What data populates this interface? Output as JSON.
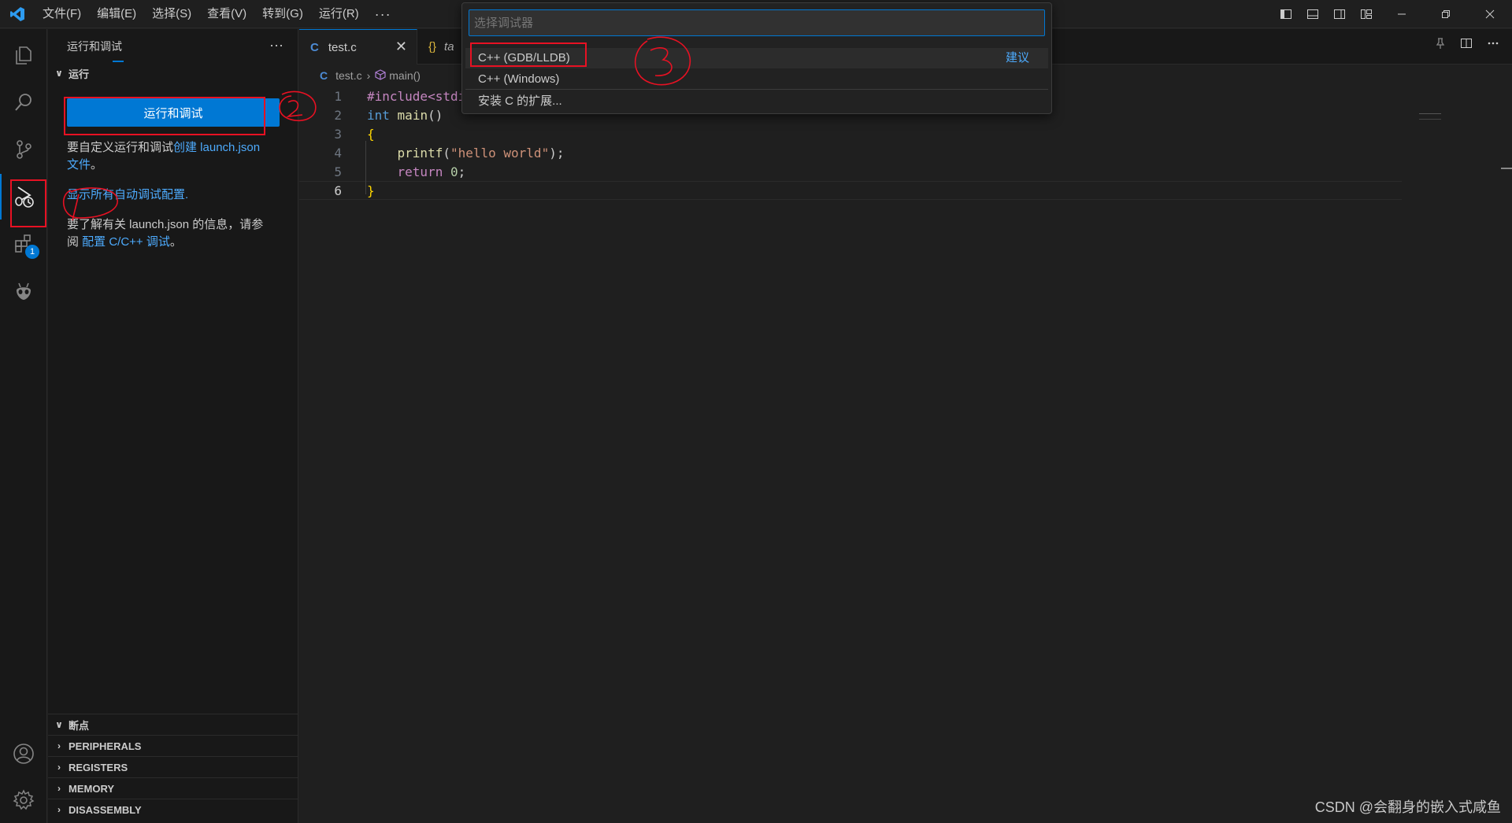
{
  "menubar": {
    "items": [
      "文件(F)",
      "编辑(E)",
      "选择(S)",
      "查看(V)",
      "转到(G)",
      "运行(R)"
    ],
    "more": "···"
  },
  "sidebar": {
    "title": "运行和调试",
    "title_more": "···",
    "section": "运行",
    "run_button": "运行和调试",
    "customize_prefix": "要自定义运行和调试",
    "customize_link_line1": "创建 launch.json",
    "customize_link_line2": "文件",
    "customize_suffix": "。",
    "show_all_link": "显示所有自动调试配置.",
    "learn_line1": "要了解有关 launch.json 的信息，请参",
    "learn_prefix2": "阅 ",
    "learn_link": "配置 C/C++ 调试",
    "learn_suffix": "。",
    "bottom_sections": [
      "断点",
      "PERIPHERALS",
      "REGISTERS",
      "MEMORY",
      "DISASSEMBLY"
    ]
  },
  "activitybar": {
    "extensions_badge": "1"
  },
  "editor": {
    "tabs": [
      {
        "icon": "C",
        "label": "test.c",
        "close": "✕"
      },
      {
        "icon": "{}",
        "label": "ta"
      }
    ],
    "breadcrumb": {
      "file_icon": "C",
      "file": "test.c",
      "symbol": "main()"
    },
    "line_numbers": [
      "1",
      "2",
      "3",
      "4",
      "5",
      "6"
    ],
    "code": {
      "l1_directive": "#include<stdi",
      "l2_kw": "int",
      "l2_fn": "main",
      "l2_rest": "()",
      "l3": "{",
      "l4_fn": "printf",
      "l4_open": "(",
      "l4_str": "\"hello world\"",
      "l4_close": ");",
      "l5_kw": "return",
      "l5_num": "0",
      "l5_end": ";",
      "l6": "}"
    }
  },
  "quickpick": {
    "placeholder": "选择调试器",
    "items": [
      {
        "label": "C++ (GDB/LLDB)",
        "tag": "建议"
      },
      {
        "label": "C++ (Windows)"
      },
      {
        "label": "安装 C 的扩展..."
      }
    ]
  },
  "watermark": "CSDN @会翻身的嵌入式咸鱼",
  "colors": {
    "accent": "#0078d4",
    "link": "#4daafc",
    "annotation": "#e81123"
  }
}
